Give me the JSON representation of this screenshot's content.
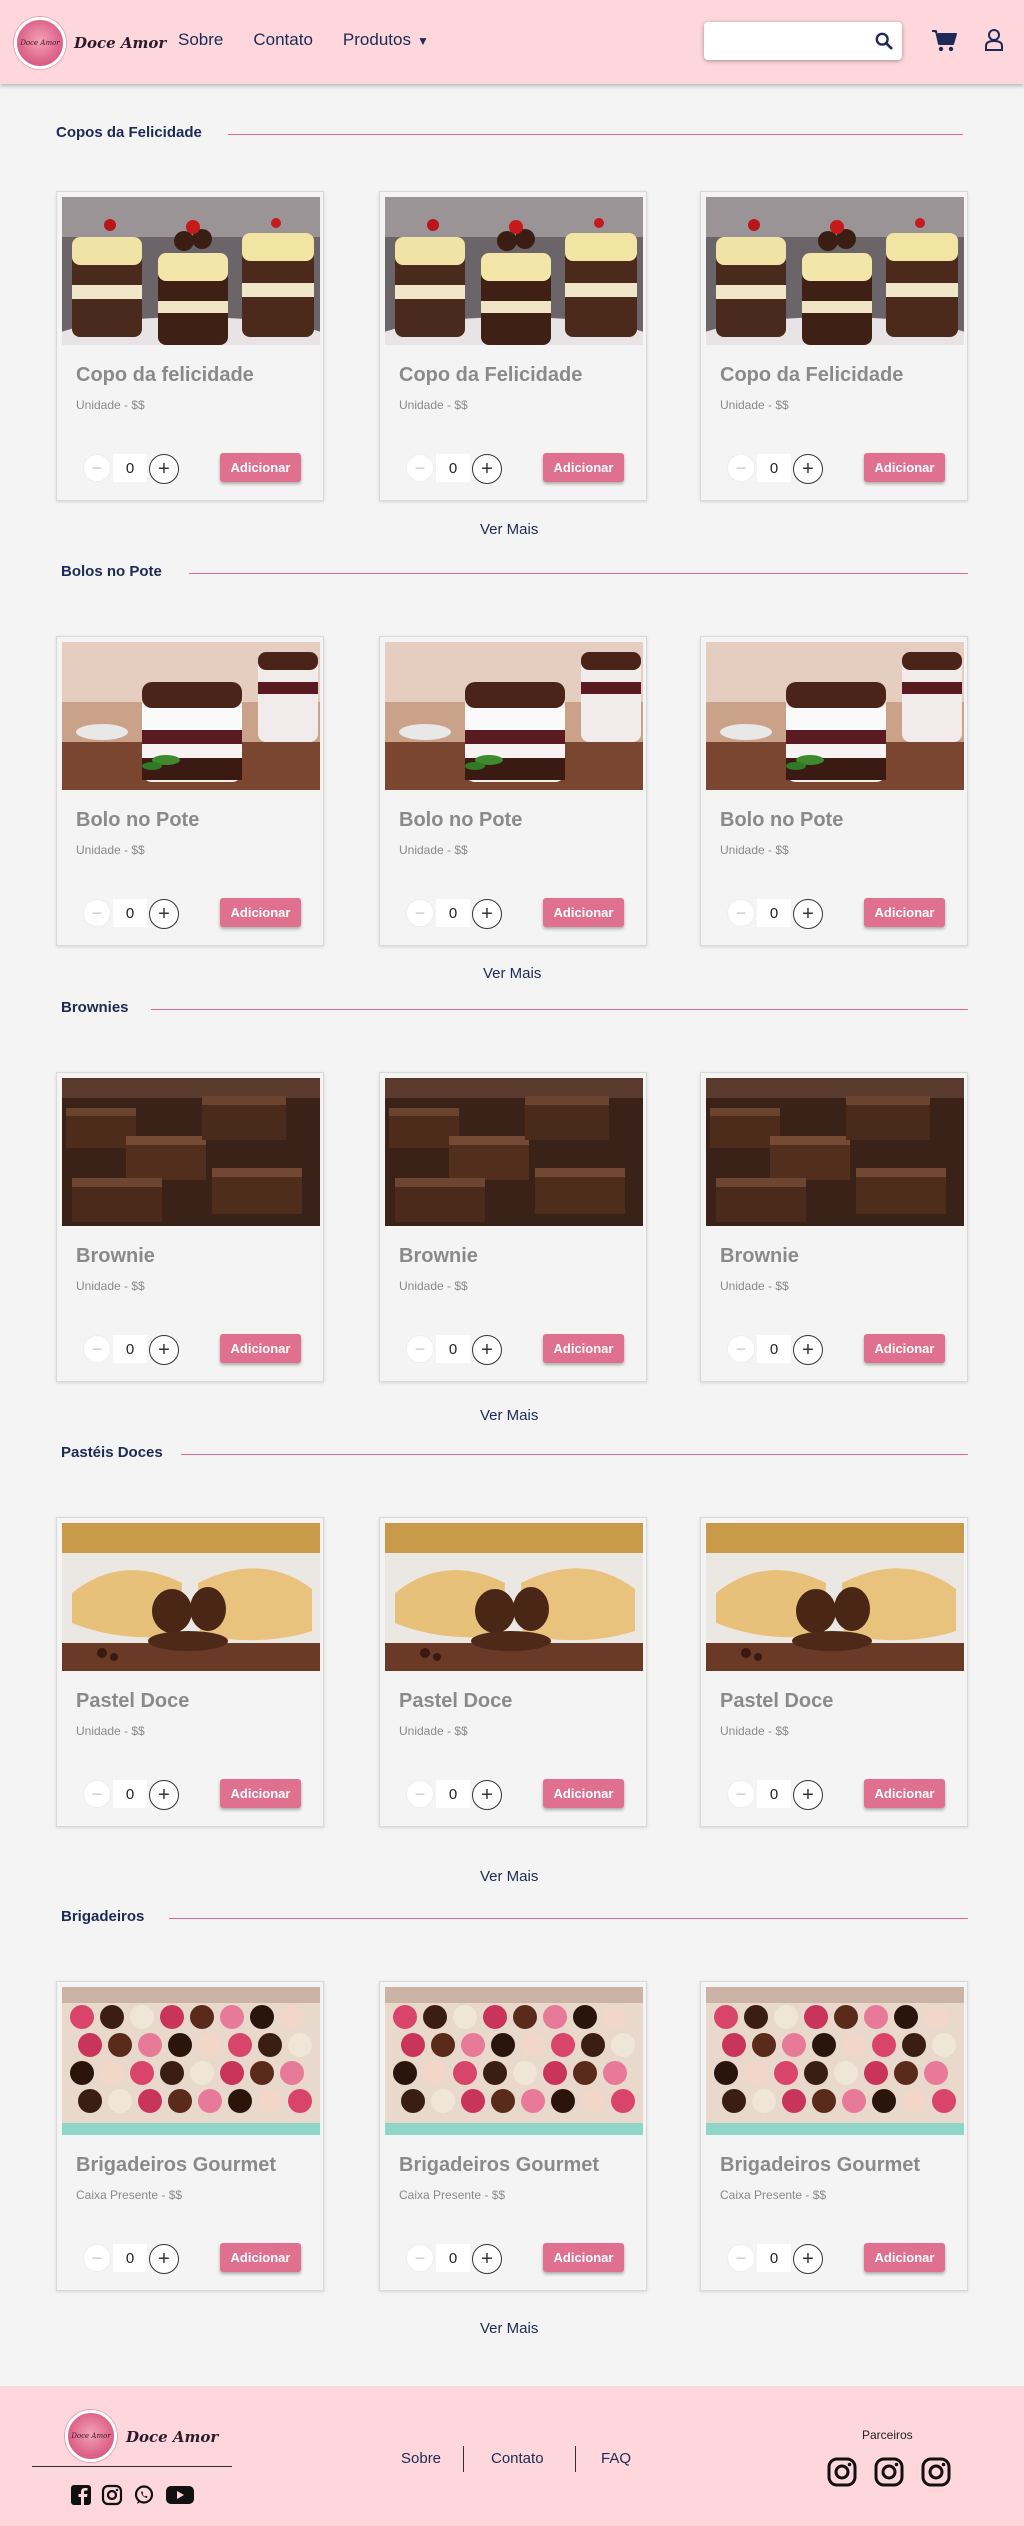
{
  "header": {
    "logo_text": "Doce Amor",
    "logo_badge": "Doce Amor",
    "nav": [
      {
        "label": "Sobre"
      },
      {
        "label": "Contato"
      },
      {
        "label": "Produtos",
        "caret": "▼"
      }
    ],
    "search": {
      "value": "",
      "placeholder": ""
    },
    "icons": [
      "search-icon",
      "cart-icon",
      "user-icon"
    ]
  },
  "sections": [
    {
      "title": "Copos da Felicidade",
      "products": [
        {
          "name": "Copo da felicidade",
          "subtitle": "Unidade - $$",
          "quantity": "0",
          "button": "Adicionar"
        },
        {
          "name": "Copo da Felicidade",
          "subtitle": "Unidade - $$",
          "quantity": "0",
          "button": "Adicionar"
        },
        {
          "name": "Copo da Felicidade",
          "subtitle": "Unidade - $$",
          "quantity": "0",
          "button": "Adicionar"
        }
      ],
      "more": "Ver Mais"
    },
    {
      "title": "Bolos no Pote",
      "products": [
        {
          "name": "Bolo no Pote",
          "subtitle": "Unidade - $$",
          "quantity": "0",
          "button": "Adicionar"
        },
        {
          "name": "Bolo no Pote",
          "subtitle": "Unidade - $$",
          "quantity": "0",
          "button": "Adicionar"
        },
        {
          "name": "Bolo no Pote",
          "subtitle": "Unidade - $$",
          "quantity": "0",
          "button": "Adicionar"
        }
      ],
      "more": "Ver Mais"
    },
    {
      "title": "Brownies",
      "products": [
        {
          "name": "Brownie",
          "subtitle": "Unidade - $$",
          "quantity": "0",
          "button": "Adicionar"
        },
        {
          "name": "Brownie",
          "subtitle": "Unidade - $$",
          "quantity": "0",
          "button": "Adicionar"
        },
        {
          "name": "Brownie",
          "subtitle": "Unidade - $$",
          "quantity": "0",
          "button": "Adicionar"
        }
      ],
      "more": "Ver Mais"
    },
    {
      "title": "Pastéis Doces",
      "products": [
        {
          "name": "Pastel Doce",
          "subtitle": "Unidade - $$",
          "quantity": "0",
          "button": "Adicionar"
        },
        {
          "name": "Pastel Doce",
          "subtitle": "Unidade - $$",
          "quantity": "0",
          "button": "Adicionar"
        },
        {
          "name": "Pastel Doce",
          "subtitle": "Unidade - $$",
          "quantity": "0",
          "button": "Adicionar"
        }
      ],
      "more": "Ver Mais"
    },
    {
      "title": "Brigadeiros",
      "products": [
        {
          "name": "Brigadeiros Gourmet",
          "subtitle": "Caixa Presente - $$",
          "quantity": "0",
          "button": "Adicionar"
        },
        {
          "name": "Brigadeiros Gourmet",
          "subtitle": "Caixa Presente - $$",
          "quantity": "0",
          "button": "Adicionar"
        },
        {
          "name": "Brigadeiros Gourmet",
          "subtitle": "Caixa Presente - $$",
          "quantity": "0",
          "button": "Adicionar"
        }
      ],
      "more": "Ver Mais"
    }
  ],
  "footer": {
    "logo_text": "Doce Amor",
    "logo_badge": "Doce Amor",
    "social": [
      "facebook-icon",
      "instagram-icon",
      "whatsapp-icon",
      "youtube-icon"
    ],
    "nav": [
      {
        "label": "Sobre"
      },
      {
        "label": "Contato"
      },
      {
        "label": "FAQ"
      }
    ],
    "partners_title": "Parceiros",
    "partners": [
      "instagram-icon",
      "instagram-icon",
      "instagram-icon"
    ]
  },
  "colors": {
    "header_bg": "#fdd7dc",
    "accent": "#e0708f",
    "text_dark": "#1e2a55",
    "page_bg": "#f4f4f4"
  }
}
